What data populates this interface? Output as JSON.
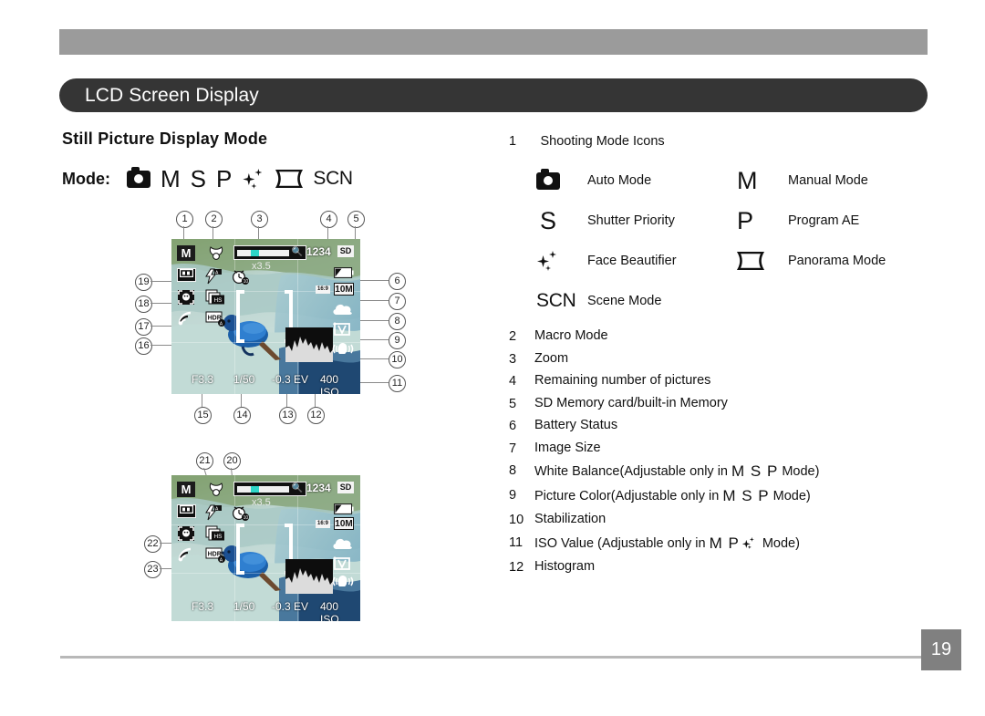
{
  "header": {
    "title": "LCD Screen Display"
  },
  "left": {
    "section_title": "Still Picture Display Mode",
    "mode_label": "Mode:",
    "mode_icons": [
      "camera-auto",
      "M",
      "S",
      "P",
      "face-beautifier",
      "panorama",
      "SCN"
    ],
    "scn_text": "SCN"
  },
  "lcd": {
    "mode_badge": "M",
    "zoom_value": "x3.5",
    "remaining": "1234",
    "card": "SD",
    "aspect": "16:9",
    "image_size": "10M",
    "aperture": "F3.3",
    "shutter": "1/50",
    "ev": "-0.3 EV",
    "iso": "400 ISO",
    "hs_label": "HS",
    "hdr_label": "HDR",
    "timer_label": "10",
    "color_label": "V"
  },
  "callouts_top": [
    "1",
    "2",
    "3",
    "4",
    "5"
  ],
  "callouts_right": [
    "6",
    "7",
    "8",
    "9",
    "10",
    "11"
  ],
  "callouts_bottom": [
    "15",
    "14",
    "13",
    "12"
  ],
  "callouts_left": [
    "19",
    "18",
    "17",
    "16"
  ],
  "callouts_second": [
    "21",
    "20",
    "22",
    "23"
  ],
  "modes": [
    {
      "icon": "camera-auto",
      "label": "Auto Mode"
    },
    {
      "icon": "M",
      "label": "Manual Mode"
    },
    {
      "icon": "S",
      "label": "Shutter Priority"
    },
    {
      "icon": "P",
      "label": "Program AE"
    },
    {
      "icon": "face-beautifier",
      "label": "Face Beautifier"
    },
    {
      "icon": "panorama",
      "label": "Panorama Mode"
    },
    {
      "icon": "SCN",
      "label": "Scene Mode"
    }
  ],
  "items": [
    {
      "n": "1",
      "text": "Shooting Mode Icons"
    },
    {
      "n": "2",
      "text": "Macro Mode"
    },
    {
      "n": "3",
      "text": "Zoom"
    },
    {
      "n": "4",
      "text": "Remaining number of pictures"
    },
    {
      "n": "5",
      "text": "SD Memory card/built-in Memory"
    },
    {
      "n": "6",
      "text": "Battery Status"
    },
    {
      "n": "7",
      "text": "Image Size"
    },
    {
      "n": "8",
      "text": "White Balance(Adjustable only in M S P Mode)"
    },
    {
      "n": "9",
      "text": "Picture Color(Adjustable only in M S P Mode)"
    },
    {
      "n": "10",
      "text": "Stabilization"
    },
    {
      "n": "11",
      "text": "ISO Value (Adjustable only in M P ✦ Mode)"
    },
    {
      "n": "12",
      "text": "Histogram"
    }
  ],
  "item_parts": {
    "i8_a": "White Balance(Adjustable only in ",
    "i8_g": "M S P",
    "i8_b": " Mode)",
    "i9_a": "Picture Color(Adjustable only in ",
    "i9_g": "M S P",
    "i9_b": " Mode)",
    "i11_a": "ISO Value (Adjustable only in ",
    "i11_g": "M P",
    "i11_b": " Mode)"
  },
  "footer": {
    "page": "19"
  }
}
